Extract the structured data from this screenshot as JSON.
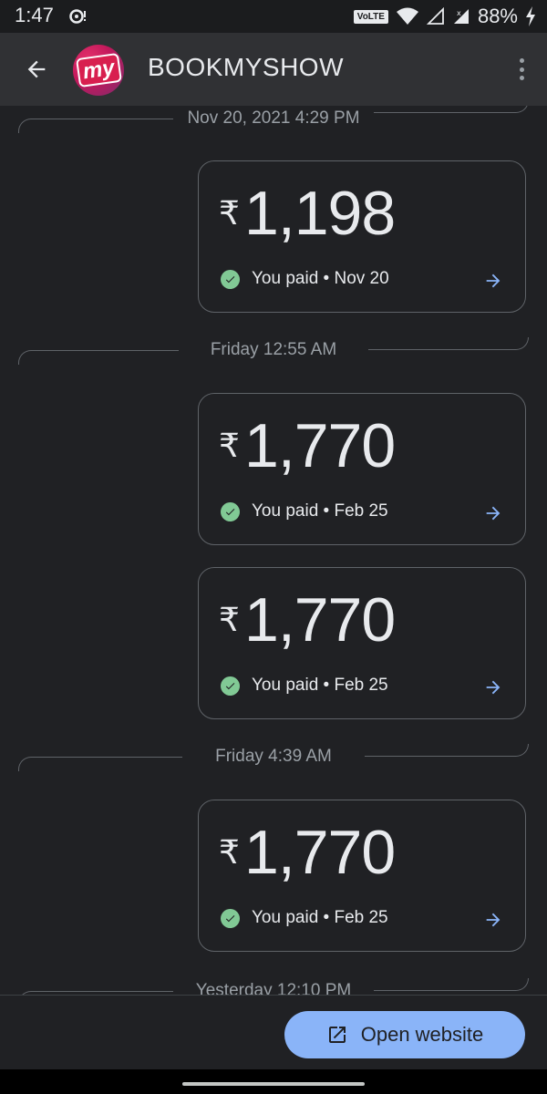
{
  "status_bar": {
    "time": "1:47",
    "volte": "VoLTE",
    "battery": "88%"
  },
  "app_bar": {
    "title": "BOOKMYSHOW",
    "logo_text": "my"
  },
  "feed": {
    "sections": [
      {
        "timestamp": "Nov 20, 2021 4:29 PM",
        "payments": [
          {
            "currency": "₹",
            "amount": "1,198",
            "status": "You paid • Nov 20"
          }
        ]
      },
      {
        "timestamp": "Friday 12:55 AM",
        "payments": [
          {
            "currency": "₹",
            "amount": "1,770",
            "status": "You paid • Feb 25"
          },
          {
            "currency": "₹",
            "amount": "1,770",
            "status": "You paid • Feb 25"
          }
        ]
      },
      {
        "timestamp": "Friday 4:39 AM",
        "payments": [
          {
            "currency": "₹",
            "amount": "1,770",
            "status": "You paid • Feb 25"
          }
        ]
      },
      {
        "timestamp": "Yesterday 12:10 PM",
        "payments": []
      }
    ]
  },
  "action": {
    "open_website_label": "Open website"
  },
  "colors": {
    "background": "#202124",
    "app_bar": "#303134",
    "accent_blue": "#8ab4f8",
    "success_green": "#81c995",
    "border": "#5f6368"
  },
  "icons": {
    "back": "arrow-back-icon",
    "menu": "more-vert-icon",
    "check": "check-circle-icon",
    "forward": "arrow-forward-icon",
    "open_external": "open-in-new-icon"
  }
}
